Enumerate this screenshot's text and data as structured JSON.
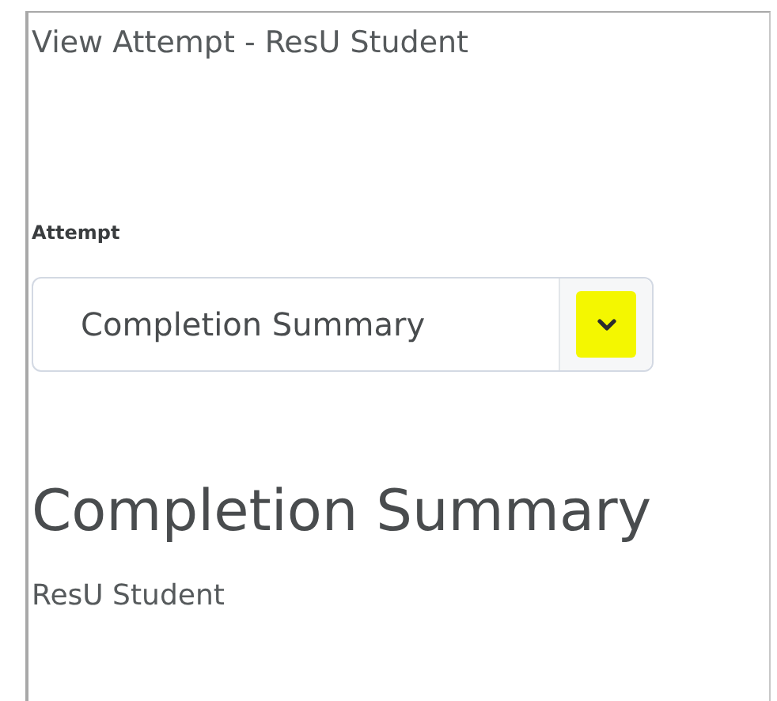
{
  "window": {
    "title": "View Attempt - ResU Student"
  },
  "attempt_select": {
    "label": "Attempt",
    "value": "Completion Summary",
    "caret_highlighted": true
  },
  "heading": "Completion Summary",
  "student_name": "ResU Student"
}
